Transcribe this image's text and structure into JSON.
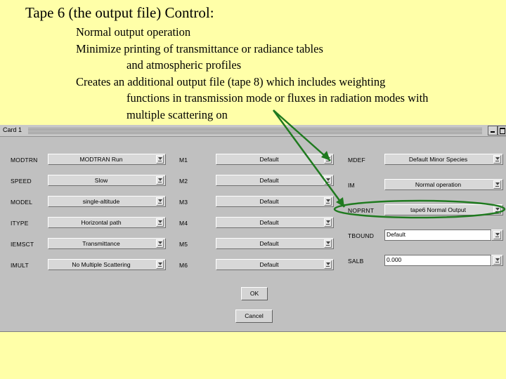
{
  "slide": {
    "title": "Tape 6 (the output file) Control:",
    "lines": [
      "Normal output operation",
      "Minimize printing of transmittance or radiance tables",
      "and atmospheric profiles",
      "Creates an additional output file (tape 8) which includes weighting",
      "functions in transmission mode or fluxes in  radiation modes with",
      "multiple scattering on"
    ]
  },
  "window": {
    "title": "Card 1"
  },
  "form": {
    "col1": [
      {
        "label": "MODTRN",
        "value": "MODTRAN Run"
      },
      {
        "label": "SPEED",
        "value": "Slow"
      },
      {
        "label": "MODEL",
        "value": "single-altitude"
      },
      {
        "label": "ITYPE",
        "value": "Horizontal path"
      },
      {
        "label": "IEMSCT",
        "value": "Transmittance"
      },
      {
        "label": "IMULT",
        "value": "No Multiple Scattering"
      }
    ],
    "col2": [
      {
        "label": "M1",
        "value": "Default"
      },
      {
        "label": "M2",
        "value": "Default"
      },
      {
        "label": "M3",
        "value": "Default"
      },
      {
        "label": "M4",
        "value": "Default"
      },
      {
        "label": "M5",
        "value": "Default"
      },
      {
        "label": "M6",
        "value": "Default"
      }
    ],
    "col3": [
      {
        "label": "MDEF",
        "value": "Default Minor Species"
      },
      {
        "label": "IM",
        "value": "Normal operation"
      },
      {
        "label": "NOPRNT",
        "value": "tape6 Normal Output"
      }
    ],
    "tbound": {
      "label": "TBOUND",
      "value": "Default"
    },
    "salb": {
      "label": "SALB",
      "value": "0.000"
    },
    "ok_label": "OK",
    "cancel_label": "Cancel"
  },
  "annotation": {
    "color": "#1f7a1f"
  }
}
